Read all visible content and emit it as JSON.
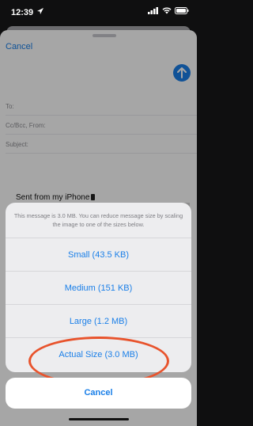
{
  "status_bar": {
    "time": "12:39",
    "icons": [
      "location-arrow-icon",
      "signal-icon",
      "wifi-icon",
      "battery-icon"
    ]
  },
  "compose": {
    "cancel_label": "Cancel",
    "fields": {
      "to": "To:",
      "cc_bcc_from": "Cc/Bcc, From:",
      "subject": "Subject:"
    },
    "signature": "Sent from my iPhone"
  },
  "action_sheet": {
    "message": "This message is 3.0 MB. You can reduce message size by scaling the image to one of the sizes below.",
    "options": [
      {
        "label": "Small (43.5 KB)"
      },
      {
        "label": "Medium (151 KB)"
      },
      {
        "label": "Large (1.2 MB)"
      },
      {
        "label": "Actual Size (3.0 MB)"
      }
    ],
    "cancel_label": "Cancel"
  },
  "colors": {
    "accent": "#1a7fe8",
    "highlight": "#e8532c"
  }
}
